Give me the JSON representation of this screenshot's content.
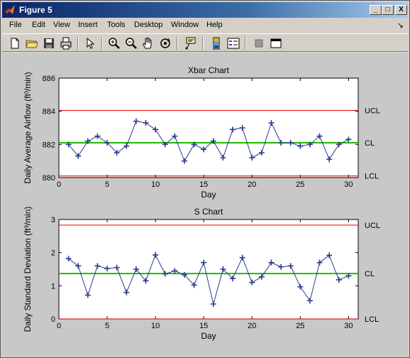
{
  "window": {
    "title": "Figure 5",
    "minimize": "_",
    "maximize": "□",
    "close": "X",
    "icon": "matlab-logo-icon"
  },
  "menu": [
    "File",
    "Edit",
    "View",
    "Insert",
    "Tools",
    "Desktop",
    "Window",
    "Help"
  ],
  "dock_arrow": "↘",
  "toolbar": [
    "new-figure-icon",
    "open-file-icon",
    "save-icon",
    "print-icon",
    "edit-plot-arrow-icon",
    "zoom-in-icon",
    "zoom-out-icon",
    "pan-hand-icon",
    "rotate-3d-icon",
    "data-cursor-icon",
    "insert-colorbar-icon",
    "insert-legend-icon",
    "hide-plot-tools-icon",
    "show-plot-tools-icon"
  ],
  "colors": {
    "series": "#283c8c",
    "center_line": "#22bb00",
    "limit_line": "#e02020",
    "axes_bg": "#ffffff",
    "figure_bg": "#c8c8c8"
  },
  "chart_data": [
    {
      "type": "line",
      "title": "Xbar Chart",
      "xlabel": "Day",
      "ylabel": "Daily Average Airflow (ft³/min)",
      "xlim": [
        0,
        31
      ],
      "ylim": [
        880,
        886
      ],
      "xticks": [
        0,
        5,
        10,
        15,
        20,
        25,
        30
      ],
      "yticks": [
        880,
        882,
        884,
        886
      ],
      "x": [
        1,
        2,
        3,
        4,
        5,
        6,
        7,
        8,
        9,
        10,
        11,
        12,
        13,
        14,
        15,
        16,
        17,
        18,
        19,
        20,
        21,
        22,
        23,
        24,
        25,
        26,
        27,
        28,
        29,
        30
      ],
      "series": [
        {
          "values": [
            882.0,
            881.3,
            882.2,
            882.5,
            882.1,
            881.5,
            881.9,
            883.4,
            883.3,
            882.9,
            882.0,
            882.5,
            881.0,
            882.0,
            881.7,
            882.2,
            881.2,
            882.9,
            883.0,
            881.2,
            881.5,
            883.3,
            882.1,
            882.1,
            881.9,
            882.0,
            882.5,
            881.1,
            882.0,
            882.3
          ]
        }
      ],
      "ucl": 884.05,
      "cl": 882.1,
      "lcl": 880.1,
      "annotations": [
        "UCL",
        "CL",
        "LCL"
      ]
    },
    {
      "type": "line",
      "title": "S Chart",
      "xlabel": "Day",
      "ylabel": "Daily Standard Deviation (ft³/min)",
      "xlim": [
        0,
        31
      ],
      "ylim": [
        0,
        3
      ],
      "xticks": [
        0,
        5,
        10,
        15,
        20,
        25,
        30
      ],
      "yticks": [
        0,
        1,
        2,
        3
      ],
      "x": [
        1,
        2,
        3,
        4,
        5,
        6,
        7,
        8,
        9,
        10,
        11,
        12,
        13,
        14,
        15,
        16,
        17,
        18,
        19,
        20,
        21,
        22,
        23,
        24,
        25,
        26,
        27,
        28,
        29,
        30
      ],
      "series": [
        {
          "values": [
            1.82,
            1.6,
            0.72,
            1.6,
            1.52,
            1.55,
            0.8,
            1.5,
            1.15,
            1.93,
            1.36,
            1.45,
            1.33,
            1.02,
            1.7,
            0.45,
            1.5,
            1.22,
            1.85,
            1.1,
            1.27,
            1.7,
            1.57,
            1.6,
            0.97,
            0.55,
            1.7,
            1.92,
            1.18,
            1.3
          ]
        }
      ],
      "ucl": 2.83,
      "cl": 1.37,
      "lcl": 0,
      "annotations": [
        "UCL",
        "CL",
        "LCL"
      ]
    }
  ]
}
